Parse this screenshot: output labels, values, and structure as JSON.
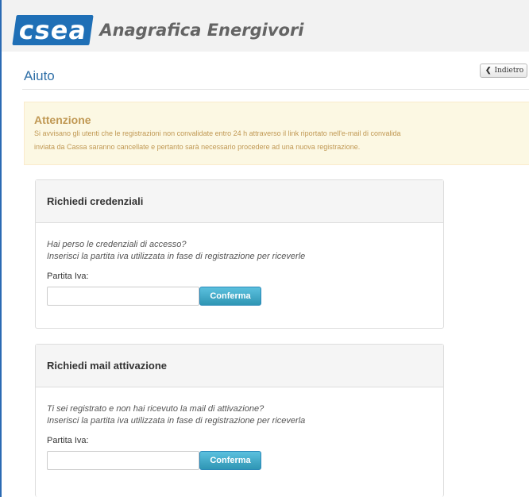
{
  "header": {
    "logo_text": "csea",
    "app_title": "Anagrafica Energivori"
  },
  "page": {
    "title": "Aiuto",
    "back_label": "Indietro"
  },
  "alert": {
    "title": "Attenzione",
    "line1": "Si avvisano gli utenti che le registrazioni non convalidate entro 24 h attraverso il link riportato nell'e-mail di convalida",
    "line2": "inviata da Cassa saranno cancellate e pertanto sarà necessario procedere ad una nuova registrazione.",
    "color": "#c09853"
  },
  "panels": [
    {
      "title": "Richiedi credenziali",
      "help1": "Hai perso le credenziali di accesso?",
      "help2": "Inserisci la partita iva utilizzata in fase di registrazione per riceverle",
      "field_label": "Partita Iva:",
      "field_value": "",
      "button_label": "Conferma"
    },
    {
      "title": "Richiedi mail attivazione",
      "help1": "Ti sei registrato e non hai ricevuto la mail di attivazione?",
      "help2": "Inserisci la partita iva utilizzata in fase di registrazione per riceverla",
      "field_label": "Partita Iva:",
      "field_value": "",
      "button_label": "Conferma"
    }
  ],
  "colors": {
    "brand_blue": "#1f6fb6",
    "title_blue": "#2f6fa7",
    "button_info": "#2f96b4"
  },
  "icons": {
    "back": "chevron-left-icon"
  }
}
